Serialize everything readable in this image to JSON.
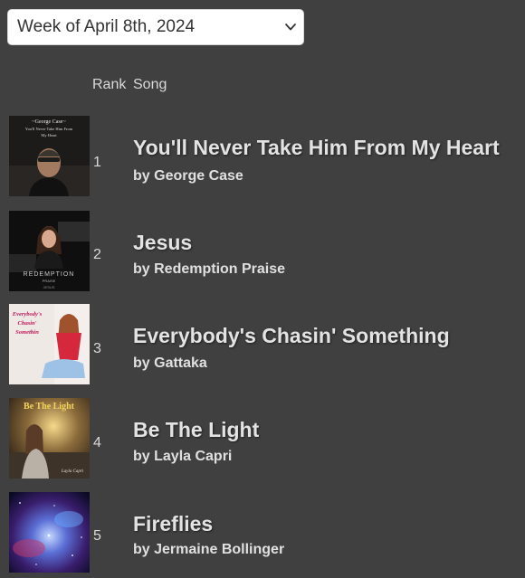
{
  "week_selector": {
    "value": "Week of April 8th, 2024",
    "icon": "chevron-down-icon"
  },
  "header": {
    "rank": "Rank",
    "song": "Song"
  },
  "songs": [
    {
      "rank": "1",
      "title": "You'll Never Take Him From My Heart",
      "artist": "by George Case",
      "cover_text": [
        "~George Case~",
        "You'll Never Take Him From",
        "My Heart"
      ]
    },
    {
      "rank": "2",
      "title": "Jesus",
      "artist": "by Redemption Praise",
      "cover_text": [
        "REDEMPTION",
        "PRAISE",
        "JESUS"
      ]
    },
    {
      "rank": "3",
      "title": "Everybody's Chasin' Something",
      "artist": "by Gattaka",
      "cover_text": [
        "Everybody's",
        "Chasin'",
        "Somethin"
      ]
    },
    {
      "rank": "4",
      "title": "Be The Light",
      "artist": "by Layla Capri",
      "cover_text": [
        "Be The Light",
        "Layla Capri"
      ]
    },
    {
      "rank": "5",
      "title": "Fireflies",
      "artist": "by Jermaine Bollinger",
      "cover_text": []
    }
  ]
}
